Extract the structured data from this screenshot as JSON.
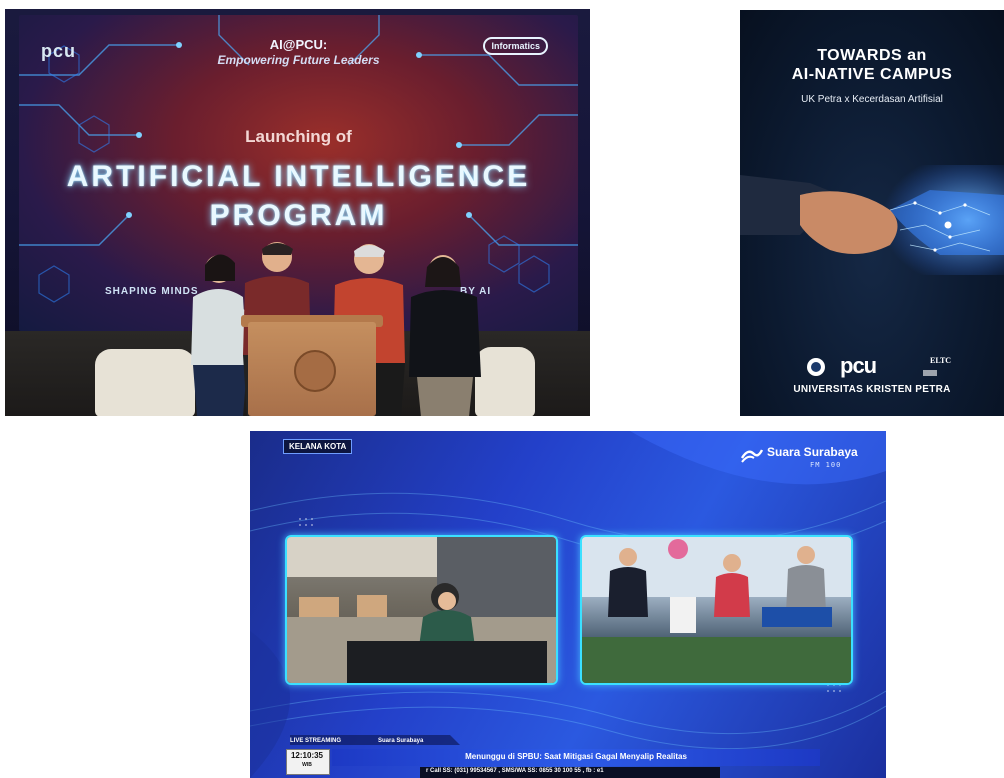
{
  "photo_launch": {
    "screen_logo_left": "pcu",
    "screen_logo_right": "Informatics",
    "title_line1": "AI@PCU:",
    "title_line2": "Empowering Future Leaders",
    "subtitle": "Launching of",
    "headline_line1": "ARTIFICIAL INTELLIGENCE",
    "headline_line2": "PROGRAM",
    "tagline_left": "SHAPING MINDS",
    "tagline_right": "BY AI"
  },
  "poster": {
    "title_line1": "TOWARDS an",
    "title_line2": "AI-NATIVE CAMPUS",
    "subtitle": "UK Petra x Kecerdasan Artifisial",
    "logo_pcu": "pcu",
    "logo_eltc": "ELTC",
    "footer": "UNIVERSITAS KRISTEN PETRA"
  },
  "broadcast": {
    "program_tag": "KELANA KOTA",
    "brand": "Suara Surabaya",
    "brand_sub": "FM 100",
    "live_label": "LIVE STREAMING",
    "mini_brand": "Suara Surabaya",
    "time": "12:10:35",
    "timezone": "WIB",
    "headline": "Menunggu di SPBU: Saat Mitigasi Gagal Menyalip Realitas",
    "ticker": "r Call SS: (031) 99534567 , SMS/WA SS: 0855 30 100 55 , fb : e1"
  },
  "colors": {
    "broadcast_blue": "#2340c9",
    "frame_glow": "#3be0ff",
    "poster_navy": "#0c1a30"
  }
}
